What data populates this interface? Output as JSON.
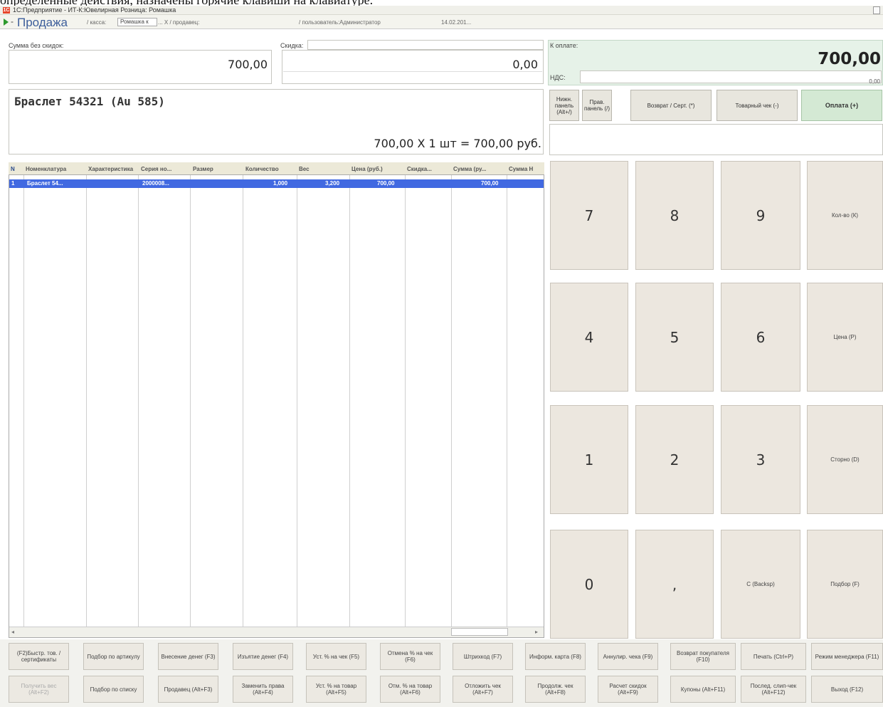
{
  "overflow_text": "определенные действия, назначены горячие клавиши на клавиатуре.",
  "title_bar": {
    "title": "1С:Предприятие - ИТ-К:Ювелирная Розница: Ромашка",
    "logo": "1С"
  },
  "form": {
    "title": "Продажа",
    "crumb_kassa": "/ касса:",
    "kassa_value": "Ромашка к",
    "crumb_prodavec": "... X / продавец:",
    "crumb_user": "/ пользователь:Администратор",
    "crumb_date": "14.02.201..."
  },
  "fields": {
    "sum_label": "Сумма без скидок:",
    "sum_value": "700,00",
    "discount_label": "Скидка:",
    "discount_value": "0,00",
    "pay_label": "К оплате:",
    "pay_value": "700,00",
    "vat_label": "НДС:",
    "vat_value": "0,00"
  },
  "item": {
    "name": "Браслет 54321 (Au 585)",
    "calc": "700,00  X 1 шт = 700,00  руб."
  },
  "small_buttons": {
    "left_panel": "Нижн. панель (Alt+/)",
    "right_panel": "Прав. панель (/)",
    "return": "Возврат / Серт. (*)",
    "receipt": "Товарный чек (-)",
    "pay": "Оплата (+)"
  },
  "table": {
    "headers": [
      "N",
      "Номенклатура",
      "Характеристика",
      "Серия но...",
      "Размер",
      "Количество",
      "Вес",
      "Цена (руб.)",
      "Скидка...",
      "Сумма (ру...",
      "Сумма Н"
    ],
    "rows": [
      [
        "1",
        "Браслет 54...",
        "",
        "2000008...",
        "",
        "1,000",
        "3,200",
        "700,00",
        "",
        "700,00",
        ""
      ]
    ]
  },
  "keypad": {
    "k7": "7",
    "k8": "8",
    "k9": "9",
    "qty": "Кол-во (К)",
    "k4": "4",
    "k5": "5",
    "k6": "6",
    "price": "Цена (Р)",
    "k1": "1",
    "k2": "2",
    "k3": "3",
    "cancel": "Сторно (D)",
    "k0": "0",
    "comma": ",",
    "clear": "C (Backsp)",
    "select": "Подбор (F)"
  },
  "function_buttons": {
    "row1": [
      "(F2)Быстр. тов. / сертификаты",
      "Подбор по артикулу",
      "Внесение денег (F3)",
      "Изъятие денег (F4)",
      "Уст. % на чек (F5)",
      "Отмена % на чек (F6)",
      "Штрихкод (F7)",
      "Информ. карта (F8)",
      "Аннулир. чека (F9)",
      "Возврат покупателя (F10)",
      "Печать (Ctrl+P)",
      "Режим менеджера (F11)"
    ],
    "row2": [
      "Получить вес (Alt+F2)",
      "Подбор по списку",
      "Продавец (Alt+F3)",
      "Заменить права (Alt+F4)",
      "Уст. % на товар (Alt+F5)",
      "Отм. % на товар (Alt+F6)",
      "Отложить чек (Alt+F7)",
      "Продолж. чек (Alt+F8)",
      "Расчет скидок (Alt+F9)",
      "Купоны (Alt+F11)",
      "Послед. слип-чек (Alt+F12)",
      "Выход (F12)"
    ]
  }
}
